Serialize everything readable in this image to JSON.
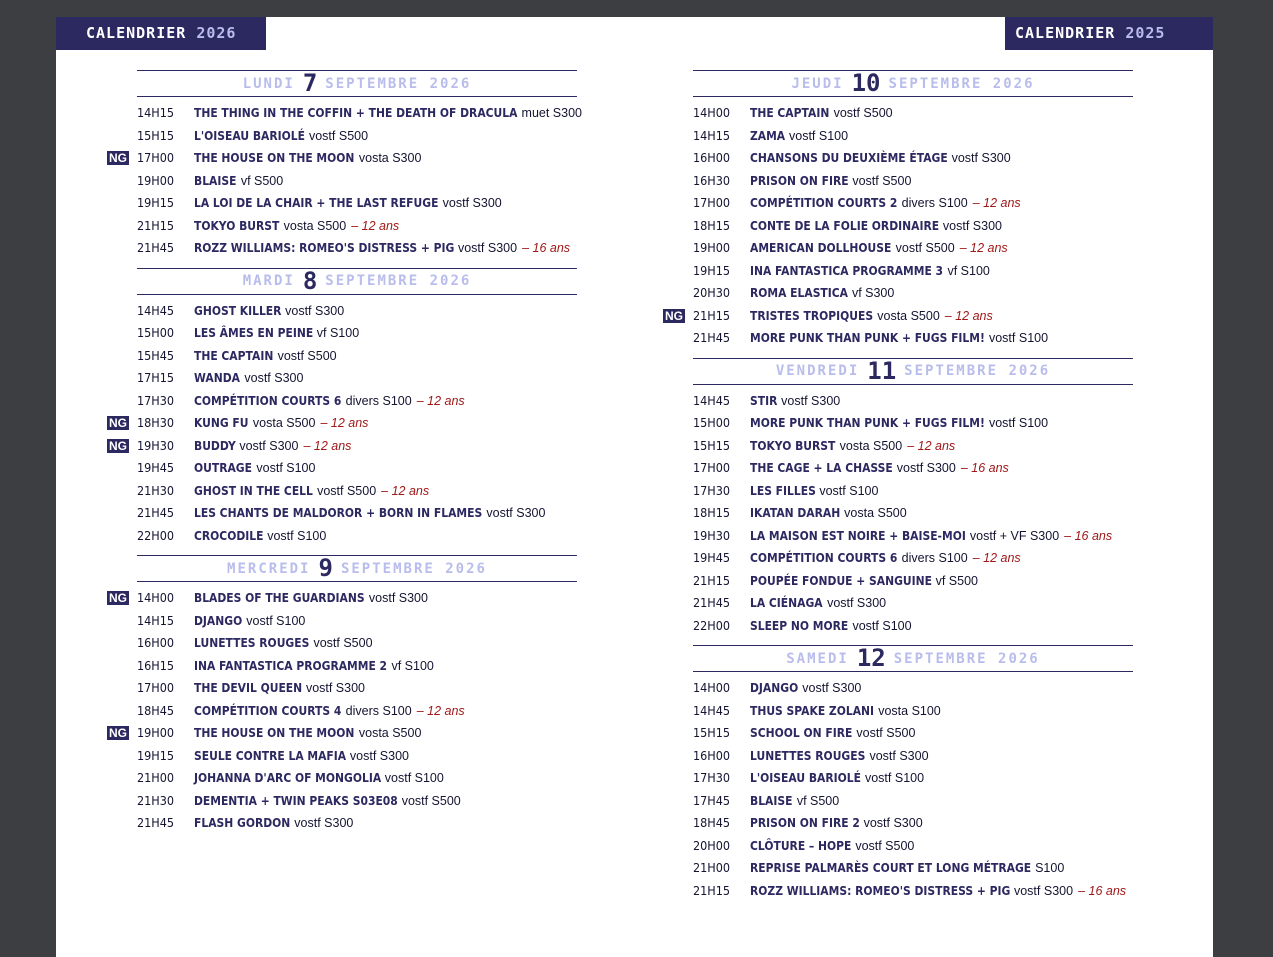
{
  "header": {
    "left_label": "CALENDRIER",
    "left_year": "2026",
    "right_label": "CALENDRIER",
    "right_year": "2025"
  },
  "days": [
    {
      "name": "LUNDI",
      "num": "7",
      "month": "SEPTEMBRE 2026",
      "items": [
        {
          "time": "14H15",
          "title": "THE THING IN THE COFFIN + THE DEATH OF DRACULA",
          "info": "muet S300"
        },
        {
          "time": "15H15",
          "title": "L'OISEAU BARIOLÉ",
          "info": "vostf S500"
        },
        {
          "time": "17H00",
          "title": "THE HOUSE ON THE MOON",
          "info": "vosta S300",
          "ng": "NG"
        },
        {
          "time": "19H00",
          "title": "BLAISE",
          "info": "vf S500"
        },
        {
          "time": "19H15",
          "title": "LA LOI DE LA CHAIR + THE LAST REFUGE",
          "info": "vostf S300"
        },
        {
          "time": "21H15",
          "title": "TOKYO BURST",
          "info": "vosta S500",
          "age": "– 12 ans"
        },
        {
          "time": "21H45",
          "title": "ROZZ WILLIAMS: ROMEO'S DISTRESS + PIG",
          "info": "vostf S300",
          "age": "– 16 ans"
        }
      ]
    },
    {
      "name": "MARDI",
      "num": "8",
      "month": "SEPTEMBRE 2026",
      "items": [
        {
          "time": "14H45",
          "title": "GHOST KILLER",
          "info": "vostf S300"
        },
        {
          "time": "15H00",
          "title": "LES ÂMES EN PEINE",
          "info": "vf S100"
        },
        {
          "time": "15H45",
          "title": "THE CAPTAIN",
          "info": "vostf S500"
        },
        {
          "time": "17H15",
          "title": "WANDA",
          "info": "vostf S300"
        },
        {
          "time": "17H30",
          "title": "COMPÉTITION COURTS 6",
          "info": "divers S100",
          "age": "– 12 ans"
        },
        {
          "time": "18H30",
          "title": "KUNG FU",
          "info": "vosta S500",
          "age": "– 12 ans",
          "ng": "NG"
        },
        {
          "time": "19H30",
          "title": "BUDDY",
          "info": "vostf S300",
          "age": "– 12 ans",
          "ng": "NG"
        },
        {
          "time": "19H45",
          "title": "OUTRAGE",
          "info": "vostf S100"
        },
        {
          "time": "21H30",
          "title": "GHOST IN THE CELL",
          "info": "vostf S500",
          "age": "– 12 ans"
        },
        {
          "time": "21H45",
          "title": "LES CHANTS DE MALDOROR + BORN IN FLAMES",
          "info": "vostf S300"
        },
        {
          "time": "22H00",
          "title": "CROCODILE",
          "info": "vostf S100"
        }
      ]
    },
    {
      "name": "MERCREDI",
      "num": "9",
      "month": "SEPTEMBRE 2026",
      "items": [
        {
          "time": "14H00",
          "title": "BLADES OF THE GUARDIANS",
          "info": "vostf S300",
          "ng": "NG"
        },
        {
          "time": "14H15",
          "title": "DJANGO",
          "info": "vostf S100"
        },
        {
          "time": "16H00",
          "title": "LUNETTES ROUGES",
          "info": "vostf S500"
        },
        {
          "time": "16H15",
          "title": "INA FANTASTICA PROGRAMME 2",
          "info": "vf S100"
        },
        {
          "time": "17H00",
          "title": "THE DEVIL QUEEN",
          "info": "vostf S300"
        },
        {
          "time": "18H45",
          "title": "COMPÉTITION COURTS 4",
          "info": "divers S100",
          "age": "– 12 ans"
        },
        {
          "time": "19H00",
          "title": "THE HOUSE ON THE MOON",
          "info": "vosta S500",
          "ng": "NG"
        },
        {
          "time": "19H15",
          "title": "SEULE CONTRE LA MAFIA",
          "info": "vostf S300"
        },
        {
          "time": "21H00",
          "title": "JOHANNA D'ARC OF MONGOLIA",
          "info": "vostf S100"
        },
        {
          "time": "21H30",
          "title": "DEMENTIA + TWIN PEAKS S03E08",
          "info": "vostf S500"
        },
        {
          "time": "21H45",
          "title": "FLASH GORDON",
          "info": "vostf S300"
        }
      ]
    },
    {
      "name": "JEUDI",
      "num": "10",
      "month": "SEPTEMBRE 2026",
      "items": [
        {
          "time": "14H00",
          "title": "THE CAPTAIN",
          "info": "vostf S500"
        },
        {
          "time": "14H15",
          "title": "ZAMA",
          "info": "vostf S100"
        },
        {
          "time": "16H00",
          "title": "CHANSONS DU DEUXIÈME ÉTAGE",
          "info": "vostf S300"
        },
        {
          "time": "16H30",
          "title": "PRISON ON FIRE",
          "info": "vostf S500"
        },
        {
          "time": "17H00",
          "title": "COMPÉTITION COURTS 2",
          "info": "divers S100",
          "age": "– 12 ans"
        },
        {
          "time": "18H15",
          "title": "CONTE DE LA FOLIE ORDINAIRE",
          "info": "vostf S300"
        },
        {
          "time": "19H00",
          "title": "AMERICAN DOLLHOUSE",
          "info": "vostf S500",
          "age": "– 12 ans"
        },
        {
          "time": "19H15",
          "title": "INA FANTASTICA PROGRAMME 3",
          "info": "vf S100"
        },
        {
          "time": "20H30",
          "title": "ROMA ELASTICA",
          "info": "vf S300"
        },
        {
          "time": "21H15",
          "title": "TRISTES TROPIQUES",
          "info": "vosta S500",
          "age": "– 12 ans",
          "ng": "NG"
        },
        {
          "time": "21H45",
          "title": "MORE PUNK THAN PUNK + FUGS FILM!",
          "info": "vostf S100"
        }
      ]
    },
    {
      "name": "VENDREDI",
      "num": "11",
      "month": "SEPTEMBRE 2026",
      "items": [
        {
          "time": "14H45",
          "title": "STIR",
          "info": "vostf S300"
        },
        {
          "time": "15H00",
          "title": "MORE PUNK THAN PUNK + FUGS FILM!",
          "info": "vostf S100"
        },
        {
          "time": "15H15",
          "title": "TOKYO BURST",
          "info": "vosta S500",
          "age": "– 12 ans"
        },
        {
          "time": "17H00",
          "title": "THE CAGE + LA CHASSE",
          "info": "vostf S300",
          "age": "– 16 ans"
        },
        {
          "time": "17H30",
          "title": "LES FILLES",
          "info": "vostf S100"
        },
        {
          "time": "18H15",
          "title": "IKATAN DARAH",
          "info": "vosta S500"
        },
        {
          "time": "19H30",
          "title": "LA MAISON EST NOIRE + BAISE-MOI",
          "info": "vostf + VF S300",
          "age": "– 16 ans"
        },
        {
          "time": "19H45",
          "title": "COMPÉTITION COURTS 6",
          "info": "divers S100",
          "age": "– 12 ans"
        },
        {
          "time": "21H15",
          "title": "POUPÉE FONDUE + SANGUINE",
          "info": "vf S500"
        },
        {
          "time": "21H45",
          "title": "LA CIÉNAGA",
          "info": "vostf S300"
        },
        {
          "time": "22H00",
          "title": "SLEEP NO MORE",
          "info": "vostf S100"
        }
      ]
    },
    {
      "name": "SAMEDI",
      "num": "12",
      "month": "SEPTEMBRE 2026",
      "items": [
        {
          "time": "14H00",
          "title": "DJANGO",
          "info": "vostf S300"
        },
        {
          "time": "14H45",
          "title": "THUS SPAKE ZOLANI",
          "info": "vosta S100"
        },
        {
          "time": "15H15",
          "title": "SCHOOL ON FIRE",
          "info": "vostf S500"
        },
        {
          "time": "16H00",
          "title": "LUNETTES ROUGES",
          "info": "vostf S300"
        },
        {
          "time": "17H30",
          "title": "L'OISEAU BARIOLÉ",
          "info": "vostf S100"
        },
        {
          "time": "17H45",
          "title": "BLAISE",
          "info": "vf S500"
        },
        {
          "time": "18H45",
          "title": "PRISON ON FIRE 2",
          "info": "vostf S300"
        },
        {
          "time": "20H00",
          "title": "CLÔTURE – HOPE",
          "info": "vostf S500"
        },
        {
          "time": "21H00",
          "title": "REPRISE PALMARÈS COURT ET LONG MÉTRAGE",
          "info": "S100"
        },
        {
          "time": "21H15",
          "title": "ROZZ WILLIAMS: ROMEO'S DISTRESS + PIG",
          "info": "vostf S300",
          "age": "– 16 ans"
        }
      ]
    }
  ],
  "colors": {
    "navy": "#2c2860",
    "lavender": "#b9bdeb",
    "age_red": "#a01818",
    "bg_gray": "#3d3e42"
  }
}
